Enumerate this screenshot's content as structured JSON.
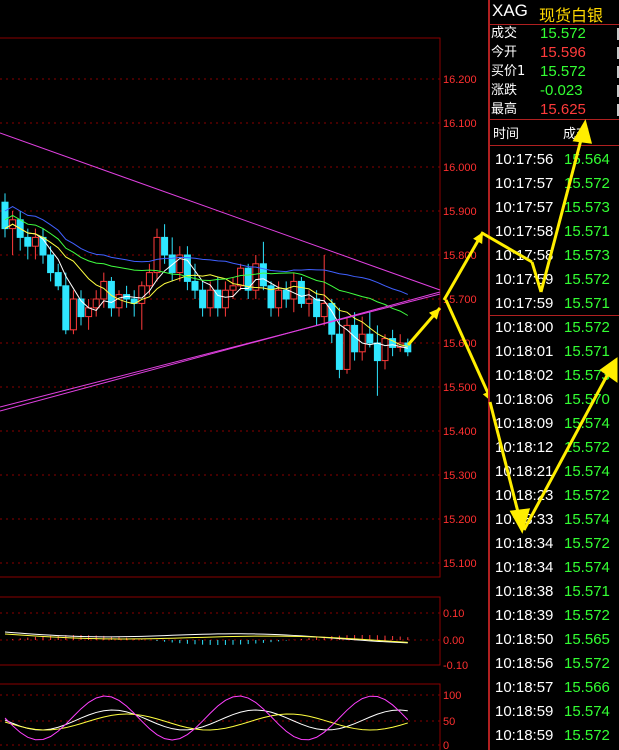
{
  "header": {
    "symbol": "XAG",
    "name": "现货白银"
  },
  "quote": [
    {
      "label": "成交",
      "value": "15.572",
      "color": "green"
    },
    {
      "label": "今开",
      "value": "15.596",
      "color": "red"
    },
    {
      "label": "买价1",
      "value": "15.572",
      "color": "green"
    },
    {
      "label": "涨跌",
      "value": "-0.023",
      "color": "green"
    },
    {
      "label": "最高",
      "value": "15.625",
      "color": "red"
    }
  ],
  "trades_header": {
    "time": "时间",
    "price": "成交"
  },
  "trades": [
    {
      "time": "10:17:56",
      "price": "15.564"
    },
    {
      "time": "10:17:57",
      "price": "15.572"
    },
    {
      "time": "10:17:57",
      "price": "15.573"
    },
    {
      "time": "10:17:58",
      "price": "15.571"
    },
    {
      "time": "10:17:58",
      "price": "15.573"
    },
    {
      "time": "10:17:59",
      "price": "15.572"
    },
    {
      "time": "10:17:59",
      "price": "15.571"
    },
    {
      "time": "10:18:00",
      "price": "15.572"
    },
    {
      "time": "10:18:01",
      "price": "15.571"
    },
    {
      "time": "10:18:02",
      "price": "15.573"
    },
    {
      "time": "10:18:06",
      "price": "15.570"
    },
    {
      "time": "10:18:09",
      "price": "15.574"
    },
    {
      "time": "10:18:12",
      "price": "15.572"
    },
    {
      "time": "10:18:21",
      "price": "15.574"
    },
    {
      "time": "10:18:23",
      "price": "15.572"
    },
    {
      "time": "10:18:33",
      "price": "15.574"
    },
    {
      "time": "10:18:34",
      "price": "15.572"
    },
    {
      "time": "10:18:34",
      "price": "15.574"
    },
    {
      "time": "10:18:38",
      "price": "15.571"
    },
    {
      "time": "10:18:39",
      "price": "15.572"
    },
    {
      "time": "10:18:50",
      "price": "15.565"
    },
    {
      "time": "10:18:56",
      "price": "15.572"
    },
    {
      "time": "10:18:57",
      "price": "15.566"
    },
    {
      "time": "10:18:59",
      "price": "15.574"
    },
    {
      "time": "10:18:59",
      "price": "15.572"
    }
  ],
  "main_axis": {
    "ticks": [
      "16.200",
      "16.100",
      "16.000",
      "15.900",
      "15.800",
      "15.700",
      "15.600",
      "15.500",
      "15.400",
      "15.300",
      "15.200",
      "15.100"
    ]
  },
  "macd_axis": {
    "ticks": [
      "0.10",
      "0.00",
      "-0.10"
    ]
  },
  "kdj_axis": {
    "ticks": [
      "100",
      "50",
      "0"
    ]
  },
  "colors": {
    "up": "#ff3b3b",
    "down": "#2fe6ff",
    "grid": "#8a0000",
    "ma5": "#ffffff",
    "ma10": "#ffff40",
    "ma20": "#ff40ff",
    "ma30": "#40ff40",
    "ma60": "#4060ff",
    "trend": "#e040e0",
    "arrow": "#ffee00"
  },
  "candles": [
    {
      "o": 15.92,
      "h": 15.94,
      "l": 15.84,
      "c": 15.86
    },
    {
      "o": 15.86,
      "h": 15.9,
      "l": 15.8,
      "c": 15.88
    },
    {
      "o": 15.88,
      "h": 15.9,
      "l": 15.81,
      "c": 15.84
    },
    {
      "o": 15.84,
      "h": 15.86,
      "l": 15.79,
      "c": 15.82
    },
    {
      "o": 15.82,
      "h": 15.86,
      "l": 15.79,
      "c": 15.84
    },
    {
      "o": 15.84,
      "h": 15.86,
      "l": 15.78,
      "c": 15.8
    },
    {
      "o": 15.8,
      "h": 15.82,
      "l": 15.74,
      "c": 15.76
    },
    {
      "o": 15.76,
      "h": 15.78,
      "l": 15.72,
      "c": 15.73
    },
    {
      "o": 15.73,
      "h": 15.76,
      "l": 15.62,
      "c": 15.63
    },
    {
      "o": 15.63,
      "h": 15.72,
      "l": 15.62,
      "c": 15.7
    },
    {
      "o": 15.7,
      "h": 15.72,
      "l": 15.64,
      "c": 15.66
    },
    {
      "o": 15.66,
      "h": 15.7,
      "l": 15.63,
      "c": 15.68
    },
    {
      "o": 15.68,
      "h": 15.72,
      "l": 15.66,
      "c": 15.7
    },
    {
      "o": 15.7,
      "h": 15.76,
      "l": 15.68,
      "c": 15.74
    },
    {
      "o": 15.74,
      "h": 15.75,
      "l": 15.66,
      "c": 15.68
    },
    {
      "o": 15.68,
      "h": 15.72,
      "l": 15.66,
      "c": 15.71
    },
    {
      "o": 15.71,
      "h": 15.73,
      "l": 15.68,
      "c": 15.7
    },
    {
      "o": 15.7,
      "h": 15.72,
      "l": 15.66,
      "c": 15.69
    },
    {
      "o": 15.69,
      "h": 15.74,
      "l": 15.63,
      "c": 15.73
    },
    {
      "o": 15.73,
      "h": 15.78,
      "l": 15.71,
      "c": 15.76
    },
    {
      "o": 15.76,
      "h": 15.86,
      "l": 15.74,
      "c": 15.84
    },
    {
      "o": 15.84,
      "h": 15.87,
      "l": 15.78,
      "c": 15.8
    },
    {
      "o": 15.8,
      "h": 15.84,
      "l": 15.74,
      "c": 15.76
    },
    {
      "o": 15.76,
      "h": 15.82,
      "l": 15.74,
      "c": 15.8
    },
    {
      "o": 15.8,
      "h": 15.82,
      "l": 15.72,
      "c": 15.74
    },
    {
      "o": 15.74,
      "h": 15.78,
      "l": 15.7,
      "c": 15.72
    },
    {
      "o": 15.72,
      "h": 15.74,
      "l": 15.66,
      "c": 15.68
    },
    {
      "o": 15.68,
      "h": 15.74,
      "l": 15.66,
      "c": 15.72
    },
    {
      "o": 15.72,
      "h": 15.75,
      "l": 15.66,
      "c": 15.68
    },
    {
      "o": 15.68,
      "h": 15.74,
      "l": 15.66,
      "c": 15.72
    },
    {
      "o": 15.72,
      "h": 15.75,
      "l": 15.7,
      "c": 15.73
    },
    {
      "o": 15.73,
      "h": 15.78,
      "l": 15.72,
      "c": 15.77
    },
    {
      "o": 15.77,
      "h": 15.78,
      "l": 15.7,
      "c": 15.72
    },
    {
      "o": 15.72,
      "h": 15.8,
      "l": 15.7,
      "c": 15.78
    },
    {
      "o": 15.78,
      "h": 15.83,
      "l": 15.72,
      "c": 15.73
    },
    {
      "o": 15.73,
      "h": 15.74,
      "l": 15.66,
      "c": 15.68
    },
    {
      "o": 15.68,
      "h": 15.74,
      "l": 15.66,
      "c": 15.72
    },
    {
      "o": 15.72,
      "h": 15.74,
      "l": 15.68,
      "c": 15.7
    },
    {
      "o": 15.7,
      "h": 15.76,
      "l": 15.67,
      "c": 15.74
    },
    {
      "o": 15.74,
      "h": 15.75,
      "l": 15.68,
      "c": 15.69
    },
    {
      "o": 15.69,
      "h": 15.72,
      "l": 15.66,
      "c": 15.7
    },
    {
      "o": 15.7,
      "h": 15.72,
      "l": 15.64,
      "c": 15.66
    },
    {
      "o": 15.66,
      "h": 15.8,
      "l": 15.64,
      "c": 15.69
    },
    {
      "o": 15.69,
      "h": 15.7,
      "l": 15.6,
      "c": 15.62
    },
    {
      "o": 15.62,
      "h": 15.68,
      "l": 15.52,
      "c": 15.54
    },
    {
      "o": 15.54,
      "h": 15.66,
      "l": 15.53,
      "c": 15.64
    },
    {
      "o": 15.64,
      "h": 15.67,
      "l": 15.56,
      "c": 15.58
    },
    {
      "o": 15.58,
      "h": 15.66,
      "l": 15.56,
      "c": 15.62
    },
    {
      "o": 15.62,
      "h": 15.67,
      "l": 15.59,
      "c": 15.6
    },
    {
      "o": 15.6,
      "h": 15.64,
      "l": 15.48,
      "c": 15.56
    },
    {
      "o": 15.56,
      "h": 15.62,
      "l": 15.54,
      "c": 15.61
    },
    {
      "o": 15.61,
      "h": 15.63,
      "l": 15.57,
      "c": 15.59
    },
    {
      "o": 15.59,
      "h": 15.62,
      "l": 15.58,
      "c": 15.6
    },
    {
      "o": 15.6,
      "h": 15.61,
      "l": 15.57,
      "c": 15.58
    }
  ]
}
